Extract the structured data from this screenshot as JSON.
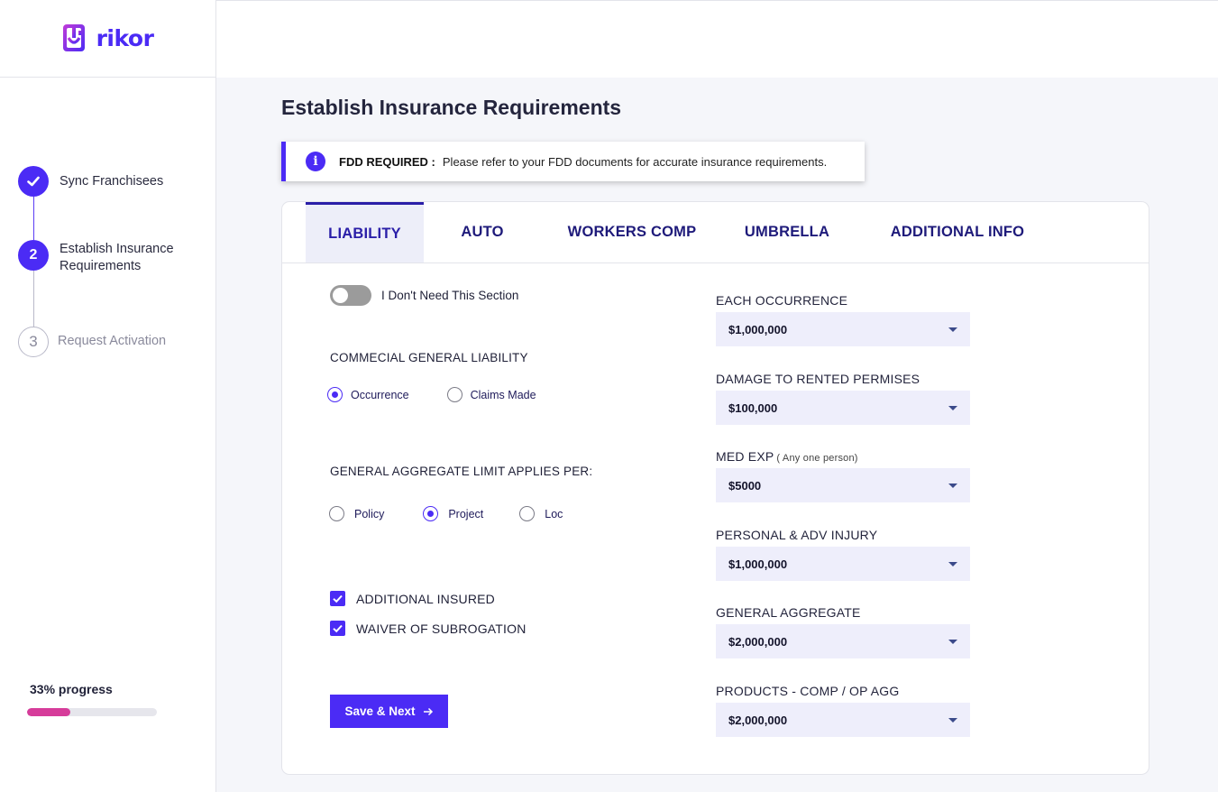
{
  "brand": {
    "name": "rikor",
    "color": "#4b2bf5"
  },
  "sidebar": {
    "steps": [
      {
        "number": "",
        "label": "Sync Franchisees",
        "state": "done"
      },
      {
        "number": "2",
        "label": "Establish Insurance Requirements",
        "state": "active"
      },
      {
        "number": "3",
        "label": "Request Activation",
        "state": "todo"
      }
    ],
    "progress": {
      "label": "33% progress",
      "percent": 33,
      "color": "#d63c9a"
    }
  },
  "page": {
    "title": "Establish Insurance Requirements",
    "notice": {
      "strong": "FDD REQUIRED :",
      "text": "Please refer to your FDD documents for accurate insurance requirements."
    }
  },
  "tabs": [
    {
      "label": "LIABILITY",
      "active": true
    },
    {
      "label": "AUTO",
      "active": false
    },
    {
      "label": "WORKERS COMP",
      "active": false
    },
    {
      "label": "UMBRELLA",
      "active": false
    },
    {
      "label": "ADDITIONAL INFO",
      "active": false
    }
  ],
  "liability": {
    "toggle_label": "I Don't Need This Section",
    "toggle_on": false,
    "cgl": {
      "title": "COMMECIAL GENERAL LIABILITY",
      "options": [
        "Occurrence",
        "Claims Made"
      ],
      "selected": "Occurrence"
    },
    "aggregate": {
      "title": "GENERAL AGGREGATE LIMIT APPLIES PER:",
      "options": [
        "Policy",
        "Project",
        "Loc"
      ],
      "selected": "Project"
    },
    "checks": [
      {
        "label": "ADDITIONAL INSURED",
        "checked": true
      },
      {
        "label": "WAIVER OF SUBROGATION",
        "checked": true
      }
    ],
    "save_label": "Save & Next",
    "limits": [
      {
        "label": "EACH OCCURRENCE",
        "sub": "",
        "value": "$1,000,000"
      },
      {
        "label": "DAMAGE TO RENTED PERMISES",
        "sub": "",
        "value": "$100,000"
      },
      {
        "label": "MED EXP",
        "sub": "( Any one person)",
        "value": "$5000"
      },
      {
        "label": "PERSONAL & ADV INJURY",
        "sub": "",
        "value": "$1,000,000"
      },
      {
        "label": "GENERAL AGGREGATE",
        "sub": "",
        "value": "$2,000,000"
      },
      {
        "label": "PRODUCTS - COMP / OP AGG",
        "sub": "",
        "value": "$2,000,000"
      }
    ]
  }
}
